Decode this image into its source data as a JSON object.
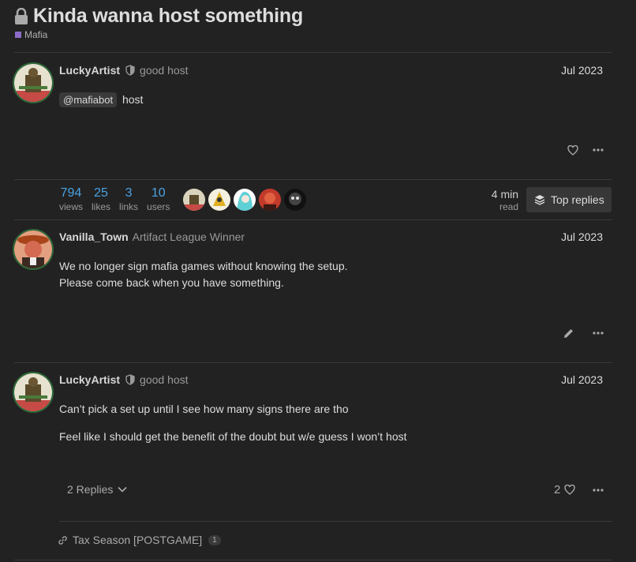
{
  "topic": {
    "title": "Kinda wanna host something",
    "category": "Mafia",
    "category_color": "#8c6bc9"
  },
  "posts": [
    {
      "username": "LuckyArtist",
      "user_title": "good host",
      "date": "Jul 2023",
      "mention": "@mafiabot",
      "text_after_mention": "host"
    },
    {
      "username": "Vanilla_Town",
      "user_title": "Artifact League Winner",
      "date": "Jul 2023",
      "lines": [
        "We no longer sign mafia games without knowing the setup.",
        "Please come back when you have something."
      ]
    },
    {
      "username": "LuckyArtist",
      "user_title": "good host",
      "date": "Jul 2023",
      "paragraphs": [
        "Can’t pick a set up until I see how many signs there are tho",
        "Feel like I should get the benefit of the doubt but w/e guess I won’t host"
      ],
      "replies_label": "2 Replies",
      "like_count": "2"
    }
  ],
  "topic_map": {
    "views": "794",
    "views_label": "views",
    "likes": "25",
    "likes_label": "likes",
    "links": "3",
    "links_label": "links",
    "users": "10",
    "users_label": "users",
    "read_time": "4 min",
    "read_label": "read",
    "top_replies_label": "Top replies"
  },
  "linked_topic": {
    "title": "Tax Season [POSTGAME]",
    "clicks": "1"
  },
  "icons": [
    "lock-icon",
    "shield-icon",
    "heart-icon",
    "ellipsis-icon",
    "pencil-icon",
    "layers-icon",
    "chevron-down-icon",
    "link-icon"
  ]
}
